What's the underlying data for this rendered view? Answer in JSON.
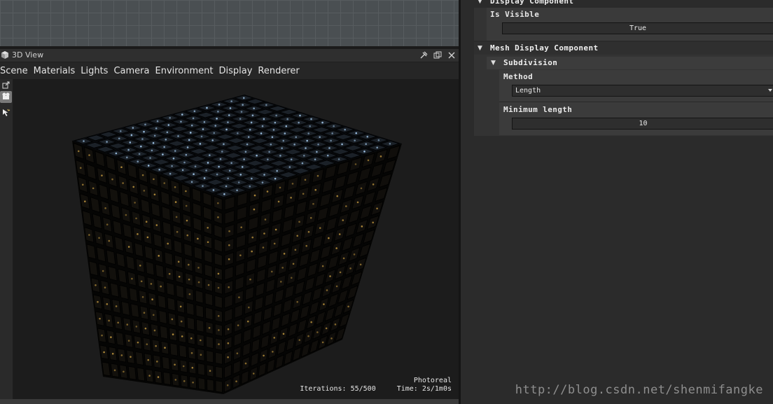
{
  "view": {
    "title": "3D View",
    "menu": [
      "Scene",
      "Materials",
      "Lights",
      "Camera",
      "Environment",
      "Display",
      "Renderer"
    ],
    "status": {
      "mode": "Photoreal",
      "iterations": "Iterations: 55/500",
      "time": "Time: 2s/1m0s"
    }
  },
  "properties": {
    "display_component": {
      "title": "Display Component",
      "visible_label": "Is Visible",
      "visible_value": "True"
    },
    "mesh_display_component": {
      "title": "Mesh Display Component",
      "subdivision": {
        "title": "Subdivision",
        "method_label": "Method",
        "method_value": "Length",
        "min_length_label": "Minimum length",
        "min_length_value": "10"
      }
    }
  },
  "watermark": "http://blog.csdn.net/shenmifangke",
  "colors": {
    "viewport_bg": "#1c1c1c",
    "panel_bg": "#2b2b2b",
    "key_highlight": "#9fc4e6",
    "glyph_gold": "#b08a3a"
  }
}
